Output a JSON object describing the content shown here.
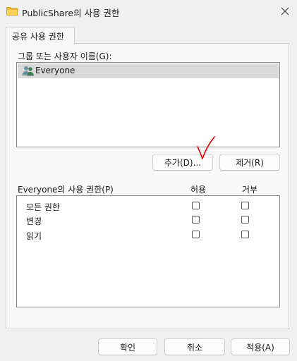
{
  "window": {
    "title": "PublicShare의 사용 권한",
    "close_label": "×"
  },
  "tab": {
    "label": "공유 사용 권한"
  },
  "groups": {
    "label": "그룹 또는 사용자 이름(G):",
    "items": [
      {
        "name": "Everyone",
        "selected": true,
        "icon": "users-icon"
      }
    ]
  },
  "buttons": {
    "add": "추가(D)...",
    "remove": "제거(R)"
  },
  "permissions": {
    "label": "Everyone의 사용 권한(P)",
    "col_allow": "허용",
    "col_deny": "거부",
    "rows": [
      {
        "name": "모든 권한",
        "allow": false,
        "deny": false
      },
      {
        "name": "변경",
        "allow": false,
        "deny": false
      },
      {
        "name": "읽기",
        "allow": false,
        "deny": false
      }
    ]
  },
  "footer": {
    "ok": "확인",
    "cancel": "취소",
    "apply": "적용(A)"
  },
  "colors": {
    "annotation": "#e00000",
    "selection": "#d9d9d9",
    "folder": "#f5c542"
  }
}
